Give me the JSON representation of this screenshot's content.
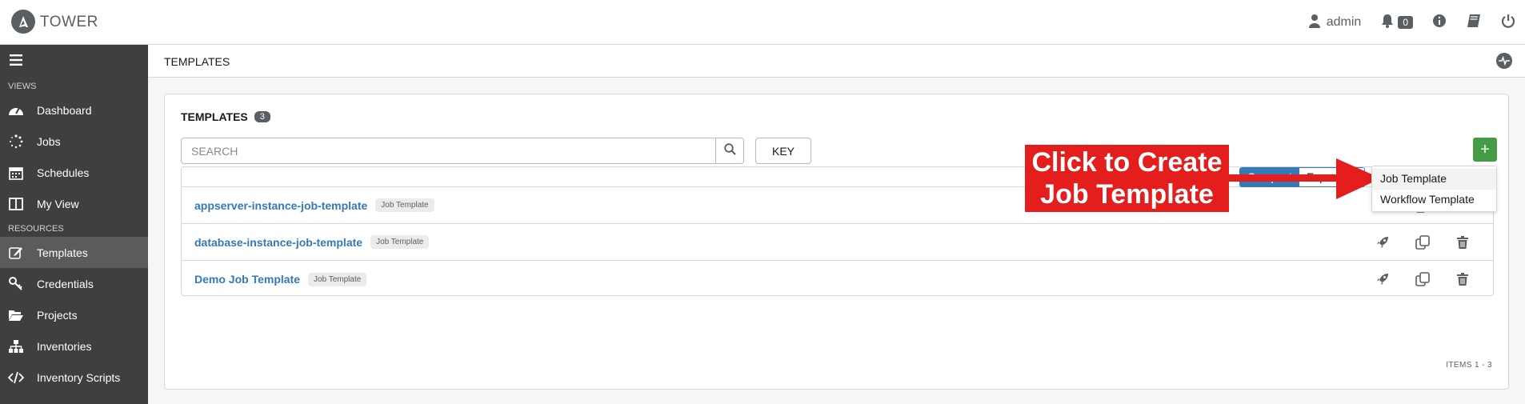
{
  "app": {
    "name": "TOWER"
  },
  "topbar": {
    "user": "admin",
    "notifications_count": "0"
  },
  "sidebar": {
    "sections": [
      {
        "label": "VIEWS",
        "items": [
          {
            "label": "Dashboard",
            "icon": "tachometer-icon"
          },
          {
            "label": "Jobs",
            "icon": "spinner-icon"
          },
          {
            "label": "Schedules",
            "icon": "calendar-icon"
          },
          {
            "label": "My View",
            "icon": "columns-icon"
          }
        ]
      },
      {
        "label": "RESOURCES",
        "items": [
          {
            "label": "Templates",
            "icon": "edit-icon",
            "active": true
          },
          {
            "label": "Credentials",
            "icon": "key-icon"
          },
          {
            "label": "Projects",
            "icon": "folder-open-icon"
          },
          {
            "label": "Inventories",
            "icon": "sitemap-icon"
          },
          {
            "label": "Inventory Scripts",
            "icon": "code-icon"
          }
        ]
      }
    ]
  },
  "page": {
    "title": "TEMPLATES"
  },
  "panel": {
    "title": "TEMPLATES",
    "count": "3",
    "search_placeholder": "SEARCH",
    "key_label": "KEY",
    "add_label": "+",
    "view_toggle": {
      "compact": "Compact",
      "expanded": "Expanded"
    },
    "items_label": "ITEMS  1 - 3",
    "rows": [
      {
        "name": "appserver-instance-job-template",
        "type": "Job Template"
      },
      {
        "name": "database-instance-job-template",
        "type": "Job Template"
      },
      {
        "name": "Demo Job Template",
        "type": "Job Template"
      }
    ]
  },
  "dropdown": {
    "items": [
      "Job Template",
      "Workflow Template"
    ]
  },
  "annotation": {
    "line1": "Click to Create",
    "line2": "Job Template"
  },
  "colors": {
    "sidebar": "#3f3f3f",
    "link": "#337ab7",
    "add": "#449d44",
    "callout": "#e41d1d"
  }
}
